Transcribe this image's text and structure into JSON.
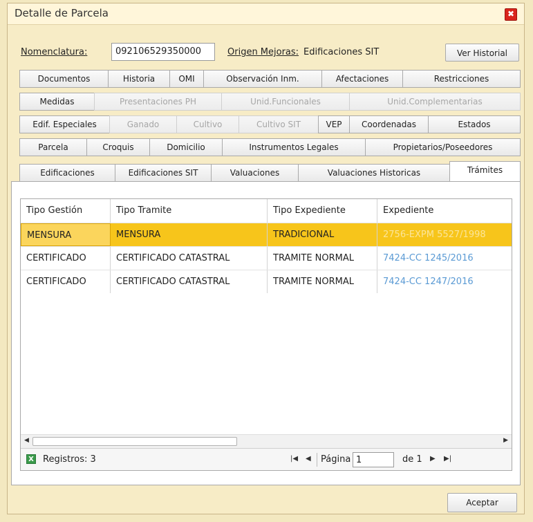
{
  "window": {
    "title": "Detalle de Parcela",
    "close_glyph": "✖"
  },
  "header": {
    "nomenclatura_label": "Nomenclatura:",
    "nomenclatura_value": "092106529350000",
    "origen_label": "Origen Mejoras:",
    "origen_value": "Edificaciones SIT",
    "historial_button": "Ver Historial"
  },
  "tabs": {
    "row1": [
      "Documentos",
      "Historia",
      "OMI",
      "Observación Inm.",
      "Afectaciones",
      "Restricciones"
    ],
    "row2": [
      "Medidas",
      "Presentaciones PH",
      "Unid.Funcionales",
      "Unid.Complementarias"
    ],
    "row3": [
      "Edif. Especiales",
      "Ganado",
      "Cultivo",
      "Cultivo SIT",
      "VEP",
      "Coordenadas",
      "Estados"
    ],
    "row4": [
      "Parcela",
      "Croquis",
      "Domicilio",
      "Instrumentos Legales",
      "Propietarios/Poseedores"
    ],
    "row5": [
      "Edificaciones",
      "Edificaciones SIT",
      "Valuaciones",
      "Valuaciones Historicas",
      "Trámites"
    ],
    "active": "Trámites"
  },
  "grid": {
    "columns": [
      "Tipo Gestión",
      "Tipo Tramite",
      "Tipo Expediente",
      "Expediente"
    ],
    "rows": [
      [
        "MENSURA",
        "MENSURA",
        "TRADICIONAL",
        "2756-EXPM 5527/1998"
      ],
      [
        "CERTIFICADO",
        "CERTIFICADO CATASTRAL",
        "TRAMITE NORMAL",
        "7424-CC 1245/2016"
      ],
      [
        "CERTIFICADO",
        "CERTIFICADO CATASTRAL",
        "TRAMITE NORMAL",
        "7424-CC 1247/2016"
      ]
    ],
    "selected_row": 0
  },
  "pager": {
    "registros_label": "Registros: 3",
    "pagina_label": "Página",
    "page_value": "1",
    "of_label": "de 1"
  },
  "footer": {
    "accept_button": "Aceptar"
  },
  "colors": {
    "selected_row": "#f7c51b",
    "link": "#5a9ad4",
    "dialog_bg": "#f7ecc6",
    "close": "#d9251c"
  }
}
